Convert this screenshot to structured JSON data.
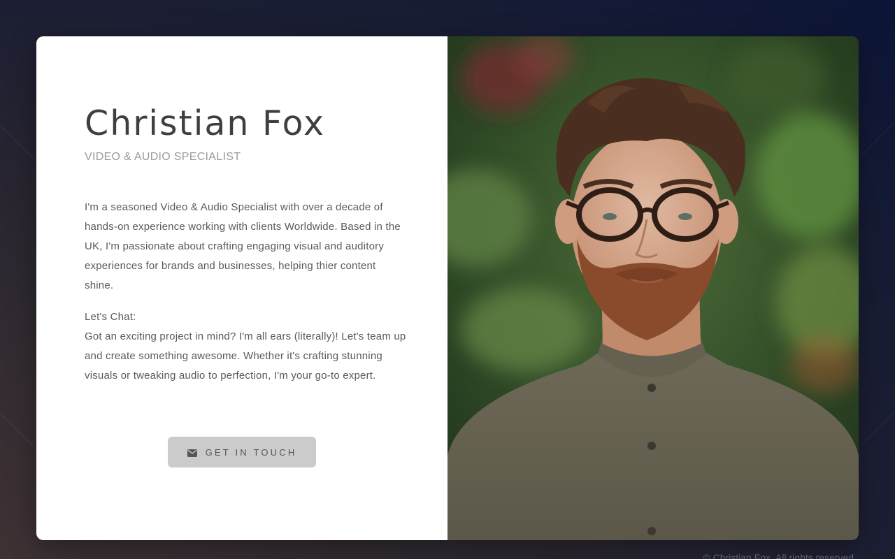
{
  "profile": {
    "name": "Christian Fox",
    "role": "VIDEO & AUDIO SPECIALIST",
    "bio": "I'm a seasoned Video & Audio Specialist with over a decade of hands-on experience working with clients Worldwide. Based in the UK, I'm passionate about crafting engaging visual and auditory experiences for brands and businesses, helping thier content shine.",
    "chat_heading": "Let's Chat:",
    "chat_body": "Got an exciting project in mind? I'm all ears (literally)! Let's team up and create something awesome. Whether it's crafting stunning visuals or tweaking audio to perfection, I'm your go-to expert."
  },
  "cta": {
    "label": "GET IN TOUCH",
    "icon": "envelope-icon"
  },
  "photo": {
    "subject": "portrait-photo"
  },
  "footer": {
    "copyright": "© Christian Fox. All rights reserved."
  },
  "colors": {
    "button_bg": "#cbcbcb",
    "name_text": "#3f3f3f",
    "body_text": "#5a5a5a"
  }
}
